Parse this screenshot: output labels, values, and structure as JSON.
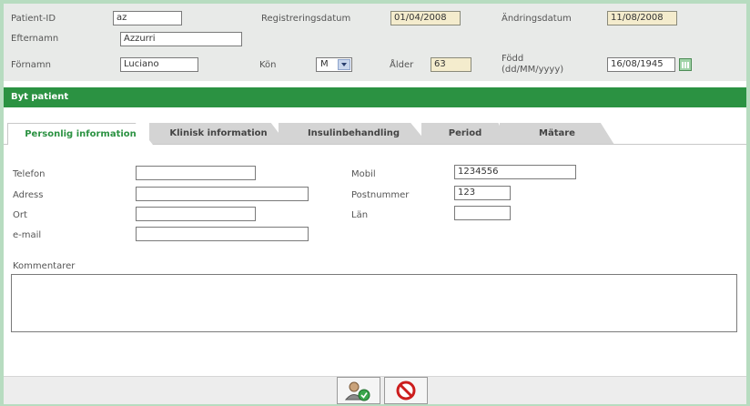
{
  "header": {
    "patient_id": {
      "label": "Patient-ID",
      "value": "az"
    },
    "registration_date": {
      "label": "Registreringsdatum",
      "value": "01/04/2008"
    },
    "change_date": {
      "label": "Ändringsdatum",
      "value": "11/08/2008"
    },
    "last_name": {
      "label": "Efternamn",
      "value": "Azzurri"
    },
    "first_name": {
      "label": "Förnamn",
      "value": "Luciano"
    },
    "gender": {
      "label": "Kön",
      "value": "M"
    },
    "age": {
      "label": "Ålder",
      "value": "63"
    },
    "birth_date": {
      "label_line1": "Född",
      "label_line2": "(dd/MM/yyyy)",
      "value": "16/08/1945"
    }
  },
  "switch_patient": {
    "label": "Byt patient"
  },
  "tabs": [
    {
      "label": "Personlig information"
    },
    {
      "label": "Klinisk information"
    },
    {
      "label": "Insulinbehandling"
    },
    {
      "label": "Period"
    },
    {
      "label": "Mätare"
    }
  ],
  "form": {
    "phone": {
      "label": "Telefon",
      "value": ""
    },
    "address": {
      "label": "Adress",
      "value": ""
    },
    "city": {
      "label": "Ort",
      "value": ""
    },
    "email": {
      "label": "e-mail",
      "value": ""
    },
    "mobile": {
      "label": "Mobil",
      "value": "1234556"
    },
    "postcode": {
      "label": "Postnummer",
      "value": "123"
    },
    "county": {
      "label": "Län",
      "value": ""
    },
    "comments": {
      "label": "Kommentarer",
      "value": ""
    }
  },
  "footer": {
    "save_icon": "save-patient-icon",
    "cancel_icon": "cancel-icon"
  },
  "colors": {
    "accent_green": "#2b9242",
    "readonly_bg": "#f4eccd",
    "cancel_red": "#cc1d1d"
  }
}
